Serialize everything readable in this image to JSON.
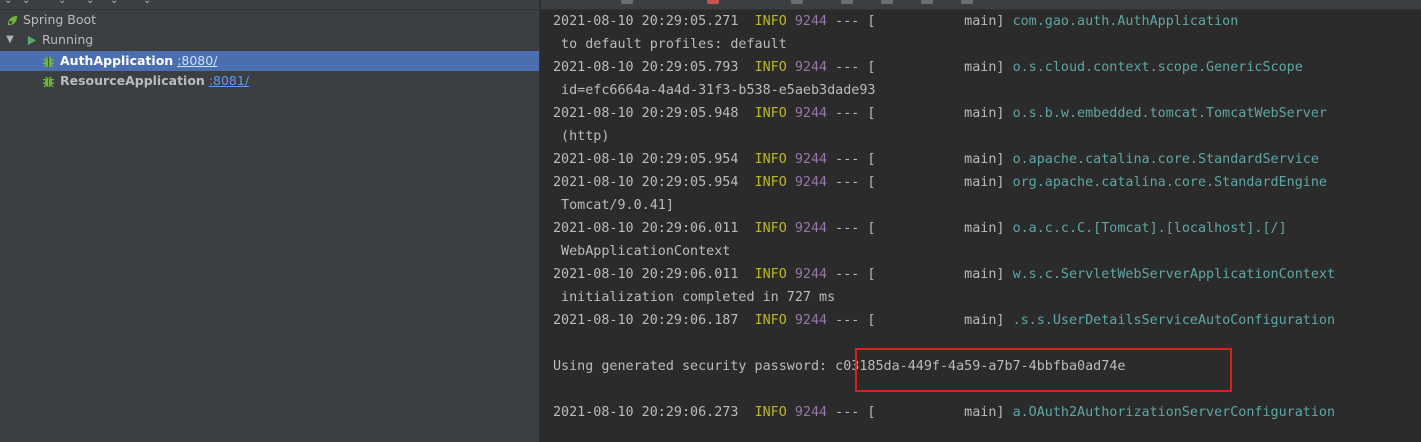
{
  "services": {
    "root_label": "Spring Boot",
    "group_label": "Running",
    "apps": [
      {
        "name": "AuthApplication",
        "port": ":8080/",
        "selected": true
      },
      {
        "name": "ResourceApplication",
        "port": ":8081/",
        "selected": false
      }
    ]
  },
  "console": {
    "lines": [
      {
        "kind": "log",
        "timestamp": "2021-08-10 20:29:05.271",
        "level": "INFO",
        "pid": "9244",
        "sep": " --- [",
        "thread": "           main]",
        "logger": "com.gao.auth.AuthApplication"
      },
      {
        "kind": "text",
        "text": " to default profiles: default"
      },
      {
        "kind": "log",
        "timestamp": "2021-08-10 20:29:05.793",
        "level": "INFO",
        "pid": "9244",
        "sep": " --- [",
        "thread": "           main]",
        "logger": "o.s.cloud.context.scope.GenericScope"
      },
      {
        "kind": "text",
        "text": " id=efc6664a-4a4d-31f3-b538-e5aeb3dade93"
      },
      {
        "kind": "log",
        "timestamp": "2021-08-10 20:29:05.948",
        "level": "INFO",
        "pid": "9244",
        "sep": " --- [",
        "thread": "           main]",
        "logger": "o.s.b.w.embedded.tomcat.TomcatWebServer"
      },
      {
        "kind": "text",
        "text": " (http)"
      },
      {
        "kind": "log",
        "timestamp": "2021-08-10 20:29:05.954",
        "level": "INFO",
        "pid": "9244",
        "sep": " --- [",
        "thread": "           main]",
        "logger": "o.apache.catalina.core.StandardService"
      },
      {
        "kind": "log",
        "timestamp": "2021-08-10 20:29:05.954",
        "level": "INFO",
        "pid": "9244",
        "sep": " --- [",
        "thread": "           main]",
        "logger": "org.apache.catalina.core.StandardEngine"
      },
      {
        "kind": "text",
        "text": " Tomcat/9.0.41]"
      },
      {
        "kind": "log",
        "timestamp": "2021-08-10 20:29:06.011",
        "level": "INFO",
        "pid": "9244",
        "sep": " --- [",
        "thread": "           main]",
        "logger": "o.a.c.c.C.[Tomcat].[localhost].[/]"
      },
      {
        "kind": "text",
        "text": " WebApplicationContext"
      },
      {
        "kind": "log",
        "timestamp": "2021-08-10 20:29:06.011",
        "level": "INFO",
        "pid": "9244",
        "sep": " --- [",
        "thread": "           main]",
        "logger": "w.s.c.ServletWebServerApplicationContext"
      },
      {
        "kind": "text",
        "text": " initialization completed in 727 ms"
      },
      {
        "kind": "log",
        "timestamp": "2021-08-10 20:29:06.187",
        "level": "INFO",
        "pid": "9244",
        "sep": " --- [",
        "thread": "           main]",
        "logger": ".s.s.UserDetailsServiceAutoConfiguration"
      },
      {
        "kind": "text",
        "text": ""
      },
      {
        "kind": "text",
        "text": "Using generated security password: c03185da-449f-4a59-a7b7-4bbfba0ad74e"
      },
      {
        "kind": "text",
        "text": ""
      },
      {
        "kind": "log",
        "timestamp": "2021-08-10 20:29:06.273",
        "level": "INFO",
        "pid": "9244",
        "sep": " --- [",
        "thread": "           main]",
        "logger": "a.OAuth2AuthorizationServerConfiguration"
      }
    ]
  },
  "colors": {
    "selection": "#4b6eaf",
    "level_info": "#bbb529",
    "pid": "#9876aa",
    "logger": "#5ea7a6",
    "highlight_box": "#e01e1e"
  }
}
